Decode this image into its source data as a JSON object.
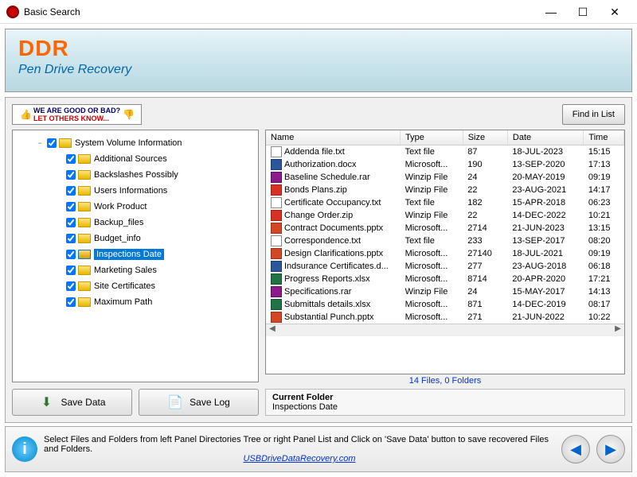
{
  "window": {
    "title": "Basic Search"
  },
  "banner": {
    "brand": "DDR",
    "subtitle": "Pen Drive Recovery"
  },
  "feedback": {
    "line1": "WE ARE GOOD OR BAD?",
    "line2": "LET OTHERS KNOW..."
  },
  "buttons": {
    "find": "Find in List",
    "save_data": "Save Data",
    "save_log": "Save Log"
  },
  "tree": {
    "items": [
      {
        "label": "System Volume Information",
        "depth": 1,
        "expander": "−",
        "checked": true
      },
      {
        "label": "Additional Sources",
        "depth": 2,
        "checked": true
      },
      {
        "label": "Backslashes Possibly",
        "depth": 2,
        "checked": true
      },
      {
        "label": "Users Informations",
        "depth": 2,
        "checked": true
      },
      {
        "label": "Work Product",
        "depth": 2,
        "checked": true
      },
      {
        "label": "Backup_files",
        "depth": 2,
        "checked": true
      },
      {
        "label": "Budget_info",
        "depth": 2,
        "checked": true
      },
      {
        "label": "Inspections Date",
        "depth": 2,
        "checked": true,
        "selected": true
      },
      {
        "label": "Marketing Sales",
        "depth": 2,
        "checked": true
      },
      {
        "label": "Site Certificates",
        "depth": 2,
        "checked": true
      },
      {
        "label": "Maximum Path",
        "depth": 2,
        "checked": true
      }
    ]
  },
  "list": {
    "columns": {
      "name": "Name",
      "type": "Type",
      "size": "Size",
      "date": "Date",
      "time": "Time"
    },
    "rows": [
      {
        "name": "Addenda file.txt",
        "ext": "txt",
        "type": "Text file",
        "size": "87",
        "date": "18-JUL-2023",
        "time": "15:15"
      },
      {
        "name": "Authorization.docx",
        "ext": "docx",
        "type": "Microsoft...",
        "size": "190",
        "date": "13-SEP-2020",
        "time": "17:13"
      },
      {
        "name": "Baseline Schedule.rar",
        "ext": "rar",
        "type": "Winzip File",
        "size": "24",
        "date": "20-MAY-2019",
        "time": "09:19"
      },
      {
        "name": "Bonds Plans.zip",
        "ext": "zip",
        "type": "Winzip File",
        "size": "22",
        "date": "23-AUG-2021",
        "time": "14:17"
      },
      {
        "name": "Certificate Occupancy.txt",
        "ext": "txt",
        "type": "Text file",
        "size": "182",
        "date": "15-APR-2018",
        "time": "06:23"
      },
      {
        "name": "Change Order.zip",
        "ext": "zip",
        "type": "Winzip File",
        "size": "22",
        "date": "14-DEC-2022",
        "time": "10:21"
      },
      {
        "name": "Contract Documents.pptx",
        "ext": "pptx",
        "type": "Microsoft...",
        "size": "2714",
        "date": "21-JUN-2023",
        "time": "13:15"
      },
      {
        "name": "Correspondence.txt",
        "ext": "txt",
        "type": "Text file",
        "size": "233",
        "date": "13-SEP-2017",
        "time": "08:20"
      },
      {
        "name": "Design Clarifications.pptx",
        "ext": "pptx",
        "type": "Microsoft...",
        "size": "27140",
        "date": "18-JUL-2021",
        "time": "09:19"
      },
      {
        "name": "Indsurance Certificates.d...",
        "ext": "docx",
        "type": "Microsoft...",
        "size": "277",
        "date": "23-AUG-2018",
        "time": "06:18"
      },
      {
        "name": "Progress Reports.xlsx",
        "ext": "xlsx",
        "type": "Microsoft...",
        "size": "8714",
        "date": "20-APR-2020",
        "time": "17:21"
      },
      {
        "name": "Specifications.rar",
        "ext": "rar",
        "type": "Winzip File",
        "size": "24",
        "date": "15-MAY-2017",
        "time": "14:13"
      },
      {
        "name": "Submittals details.xlsx",
        "ext": "xlsx",
        "type": "Microsoft...",
        "size": "871",
        "date": "14-DEC-2019",
        "time": "08:17"
      },
      {
        "name": "Substantial Punch.pptx",
        "ext": "pptx",
        "type": "Microsoft...",
        "size": "271",
        "date": "21-JUN-2022",
        "time": "10:22"
      }
    ]
  },
  "status": "14 Files, 0 Folders",
  "current_folder": {
    "heading": "Current Folder",
    "value": "Inspections Date"
  },
  "footer": {
    "tip": "Select Files and Folders from left Panel Directories Tree or right Panel List and Click on 'Save Data' button to save recovered Files and Folders.",
    "link": "USBDriveDataRecovery.com"
  }
}
